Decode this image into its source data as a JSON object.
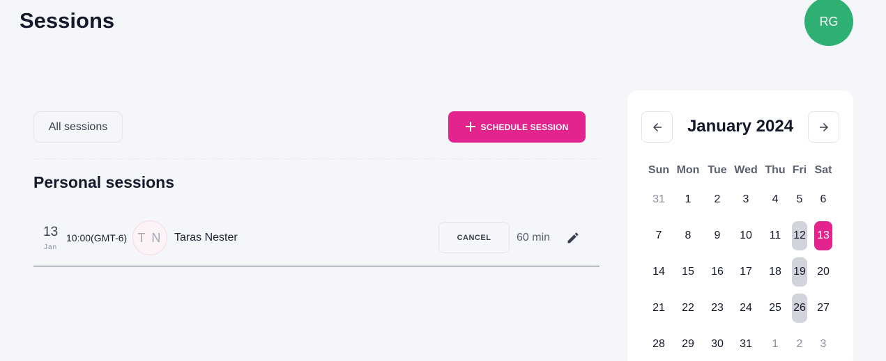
{
  "header": {
    "title": "Sessions",
    "avatar_initials": "RG",
    "avatar_color": "#2fb073"
  },
  "toolbar": {
    "filter_label": "All sessions",
    "schedule_label": "SCHEDULE SESSION",
    "accent_color": "#e3238e"
  },
  "section": {
    "title": "Personal sessions"
  },
  "session": {
    "day": "13",
    "month": "Jan",
    "time": "10:00(GMT-6)",
    "initials": "T N",
    "name": "Taras Nester",
    "cancel_label": "CANCEL",
    "duration": "60 min"
  },
  "calendar": {
    "month_label": "January 2024",
    "weekdays": [
      "Sun",
      "Mon",
      "Tue",
      "Wed",
      "Thu",
      "Fri",
      "Sat"
    ],
    "weeks": [
      [
        {
          "d": "31",
          "m": true
        },
        {
          "d": "1"
        },
        {
          "d": "2"
        },
        {
          "d": "3"
        },
        {
          "d": "4"
        },
        {
          "d": "5"
        },
        {
          "d": "6"
        }
      ],
      [
        {
          "d": "7"
        },
        {
          "d": "8"
        },
        {
          "d": "9"
        },
        {
          "d": "10"
        },
        {
          "d": "11"
        },
        {
          "d": "12",
          "hl": "grey"
        },
        {
          "d": "13",
          "hl": "pink"
        }
      ],
      [
        {
          "d": "14"
        },
        {
          "d": "15"
        },
        {
          "d": "16"
        },
        {
          "d": "17"
        },
        {
          "d": "18"
        },
        {
          "d": "19",
          "hl": "grey"
        },
        {
          "d": "20"
        }
      ],
      [
        {
          "d": "21"
        },
        {
          "d": "22"
        },
        {
          "d": "23"
        },
        {
          "d": "24"
        },
        {
          "d": "25"
        },
        {
          "d": "26",
          "hl": "grey"
        },
        {
          "d": "27"
        }
      ],
      [
        {
          "d": "28"
        },
        {
          "d": "29"
        },
        {
          "d": "30"
        },
        {
          "d": "31"
        },
        {
          "d": "1",
          "m": true
        },
        {
          "d": "2",
          "m": true
        },
        {
          "d": "3",
          "m": true
        }
      ]
    ]
  }
}
